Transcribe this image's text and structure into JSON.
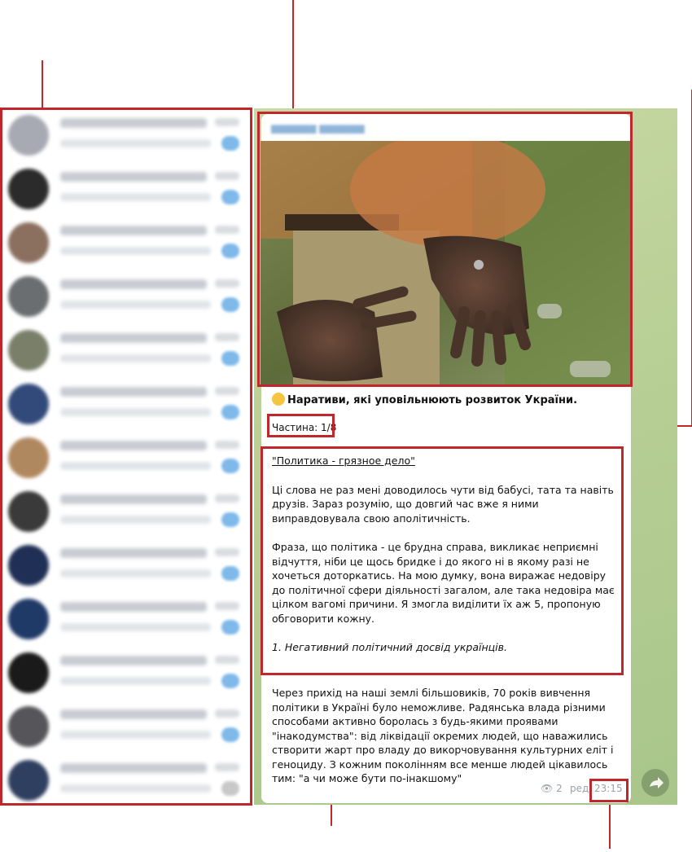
{
  "sidebar": {
    "chats": [
      {
        "avatar_color": "#a7a9b3"
      },
      {
        "avatar_color": "#2b2b2b"
      },
      {
        "avatar_color": "#8b6f5f"
      },
      {
        "avatar_color": "#6b6e70"
      },
      {
        "avatar_color": "#7a7f6a"
      },
      {
        "avatar_color": "#324a7a"
      },
      {
        "avatar_color": "#b08860"
      },
      {
        "avatar_color": "#3a3a3a"
      },
      {
        "avatar_color": "#1f2f55"
      },
      {
        "avatar_color": "#203a68"
      },
      {
        "avatar_color": "#1a1a1a"
      },
      {
        "avatar_color": "#56565a"
      },
      {
        "avatar_color": "#2f3f5f"
      }
    ]
  },
  "message": {
    "headline": "Наративи, які уповільнюють розвиток України.",
    "part_label": "Частина: 1/8",
    "link_title": "\"Политика - грязное дело\"",
    "paragraph1": "Ці слова не раз мені доводилось чути від бабусі, тата та навіть друзів. Зараз розумію, що довгий час вже я ними виправдовувала свою аполітичність.",
    "paragraph2": "Фраза, що політика - це брудна справа, викликає неприємні відчуття, ніби це щось бридке і до якого ні в якому разі не хочеться доторкатись. На мою думку, вона виражає недовіру до політичної сфери діяльності загалом, але така недовіра має цілком вагомі причини. Я змогла виділити їх аж 5, пропоную обговорити кожну.",
    "point1": "1. Негативний політичний досвід українців.",
    "paragraph3": "Через прихід на наші землі більшовиків, 70 років вивчення політики в Україні було неможливе. Радянська влада різними способами активно боролась з будь-якими проявами \"інакодумства\": від ліквідації окремих людей, що наважились створити жарт про владу до викорчовування культурних еліт і геноциду. З кожним поколінням все менше людей цікавилось тим: \"а чи може бути по-інакшому\"",
    "views": "2",
    "edited": "ред.",
    "time": "23:15"
  },
  "colors": {
    "annotation": "#c0272d",
    "chat_bg": "#b8cf95",
    "badge": "#7fb9ea"
  }
}
